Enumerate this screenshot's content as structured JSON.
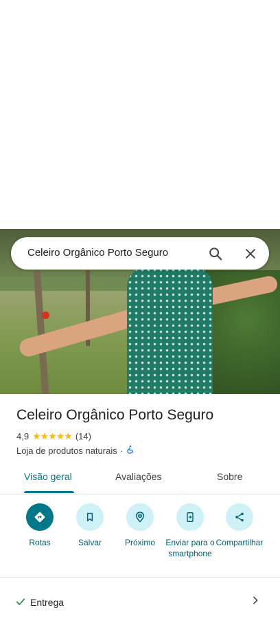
{
  "search": {
    "value": "Celeiro Orgânico Porto Seguro"
  },
  "place": {
    "name": "Celeiro Orgânico Porto Seguro",
    "rating": "4,9",
    "stars": "★★★★★",
    "review_count": "(14)",
    "category": "Loja de produtos naturais",
    "separator": "·"
  },
  "tabs": [
    {
      "label": "Visão geral",
      "active": true
    },
    {
      "label": "Avaliações",
      "active": false
    },
    {
      "label": "Sobre",
      "active": false
    }
  ],
  "actions": [
    {
      "label": "Rotas",
      "icon": "directions-icon"
    },
    {
      "label": "Salvar",
      "icon": "bookmark-icon"
    },
    {
      "label": "Próximo",
      "icon": "nearby-icon"
    },
    {
      "label": "Enviar para o smartphone",
      "icon": "send-to-phone-icon"
    },
    {
      "label": "Compartilhar",
      "icon": "share-icon"
    }
  ],
  "attributes": {
    "delivery": "Entrega"
  },
  "colors": {
    "accent": "#00788a",
    "accent_light": "#cdf1f6",
    "stars": "#fbbc04"
  }
}
